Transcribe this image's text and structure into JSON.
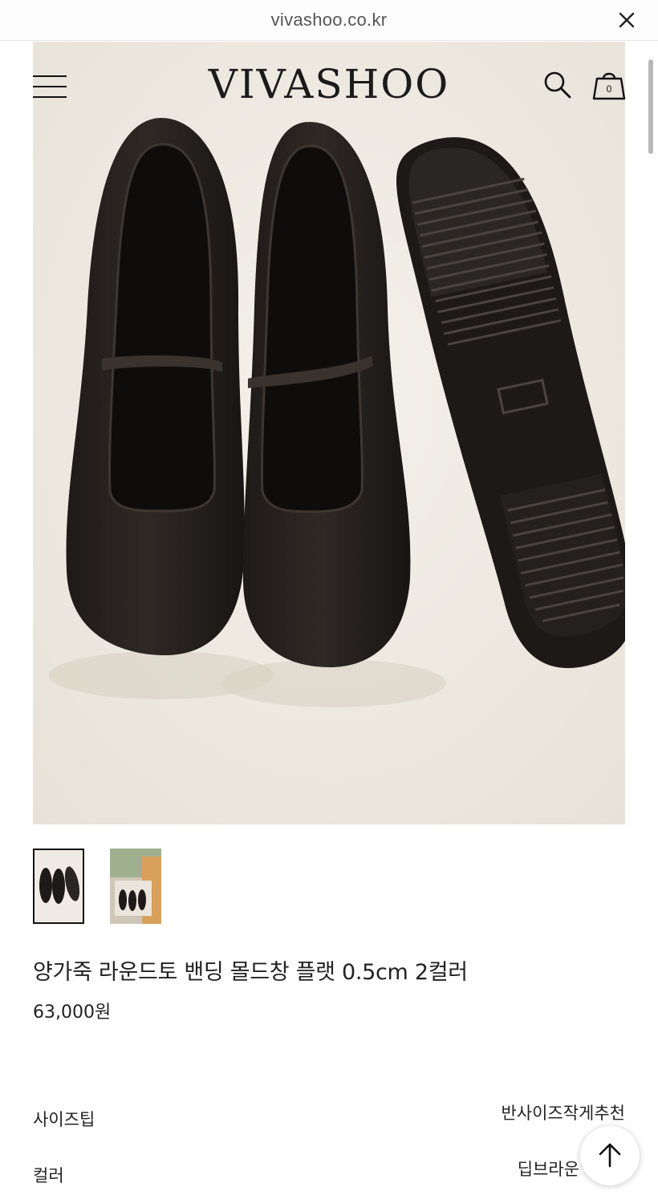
{
  "browser": {
    "url": "vivashoo.co.kr"
  },
  "header": {
    "logo": "VIVASHOO",
    "cart_count": "0"
  },
  "product": {
    "title": "양가죽 라운드토 밴딩 몰드창 플랫 0.5cm 2컬러",
    "price": "63,000원",
    "options": [
      {
        "label": "사이즈팁",
        "value": "반사이즈작게추천"
      },
      {
        "label": "컬러",
        "value": "딥브라운"
      }
    ]
  },
  "icons": [
    "close-icon",
    "menu-icon",
    "search-icon",
    "shopping-bag-icon",
    "arrow-up-icon"
  ],
  "colors": {
    "background": "#ffffff",
    "text": "#1a1a1a",
    "photo_backdrop": "#efece6"
  }
}
